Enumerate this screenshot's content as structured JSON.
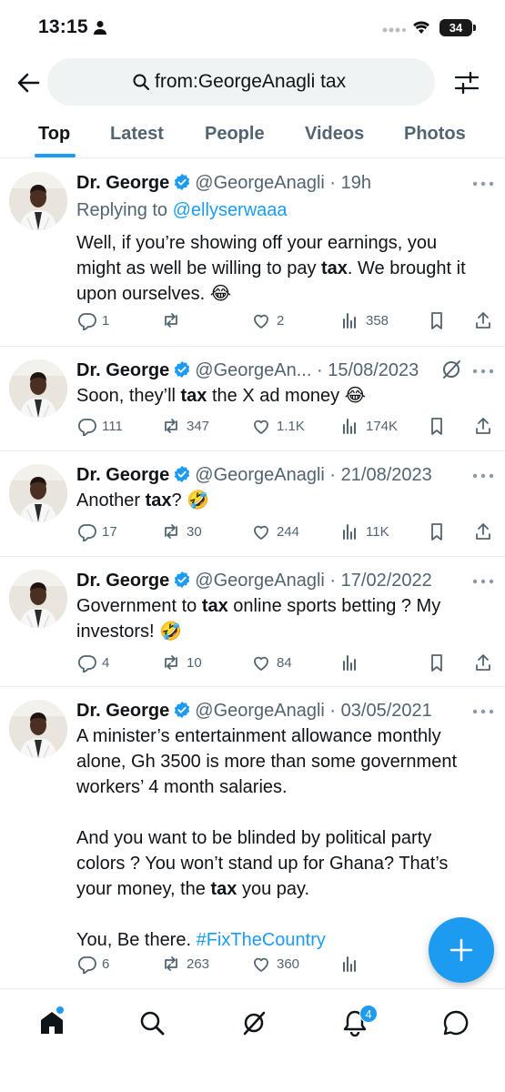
{
  "status_bar": {
    "time": "13:15",
    "battery": "34"
  },
  "search": {
    "query": "from:GeorgeAnagli tax"
  },
  "tabs": [
    {
      "label": "Top"
    },
    {
      "label": "Latest"
    },
    {
      "label": "People"
    },
    {
      "label": "Videos"
    },
    {
      "label": "Photos"
    }
  ],
  "tweets": [
    {
      "name": "Dr. George",
      "handle": "@GeorgeAnagli",
      "sep": " · ",
      "time": "19h",
      "replying_label": "Replying to ",
      "replying_to": "@ellyserwaaa",
      "text_parts": [
        "Well, if you’re showing off your earnings, you might as well be willing to pay ",
        "tax",
        ". We brought it upon ourselves. 😂"
      ],
      "replies": "1",
      "retweets": "",
      "likes": "2",
      "views": "358"
    },
    {
      "name": "Dr. George",
      "handle": "@GeorgeAn...",
      "sep": " · ",
      "time": "15/08/2023",
      "text_parts": [
        "Soon, they’ll ",
        "tax",
        " the X ad money 😂"
      ],
      "replies": "111",
      "retweets": "347",
      "likes": "1.1K",
      "views": "174K"
    },
    {
      "name": "Dr. George",
      "handle": "@GeorgeAnagli",
      "sep": " · ",
      "time": "21/08/2023",
      "text_parts": [
        "Another ",
        "tax",
        "? 🤣"
      ],
      "replies": "17",
      "retweets": "30",
      "likes": "244",
      "views": "11K"
    },
    {
      "name": "Dr. George",
      "handle": "@GeorgeAnagli",
      "sep": " · ",
      "time": "17/02/2022",
      "text_parts": [
        "Government to ",
        "tax",
        " online sports betting ? My investors! 🤣"
      ],
      "replies": "4",
      "retweets": "10",
      "likes": "84",
      "views": ""
    },
    {
      "name": "Dr. George",
      "handle": "@GeorgeAnagli",
      "sep": " · ",
      "time": "03/05/2021",
      "para1": "A minister’s entertainment allowance monthly alone, Gh 3500 is more than some government workers’ 4 month salaries.",
      "para2_parts": [
        "And you want to be blinded by political party colors ? You won’t stand up for Ghana?  That’s your money, the ",
        "tax",
        " you pay."
      ],
      "para3_text": "You, Be there. ",
      "hashtag": "#FixTheCountry",
      "replies": "6",
      "retweets": "263",
      "likes": "360",
      "views": ""
    }
  ],
  "bottom_nav": {
    "notifications_badge": "4"
  },
  "colors": {
    "accent": "#1d9bf0",
    "text": "#0f1419",
    "muted": "#536471"
  }
}
